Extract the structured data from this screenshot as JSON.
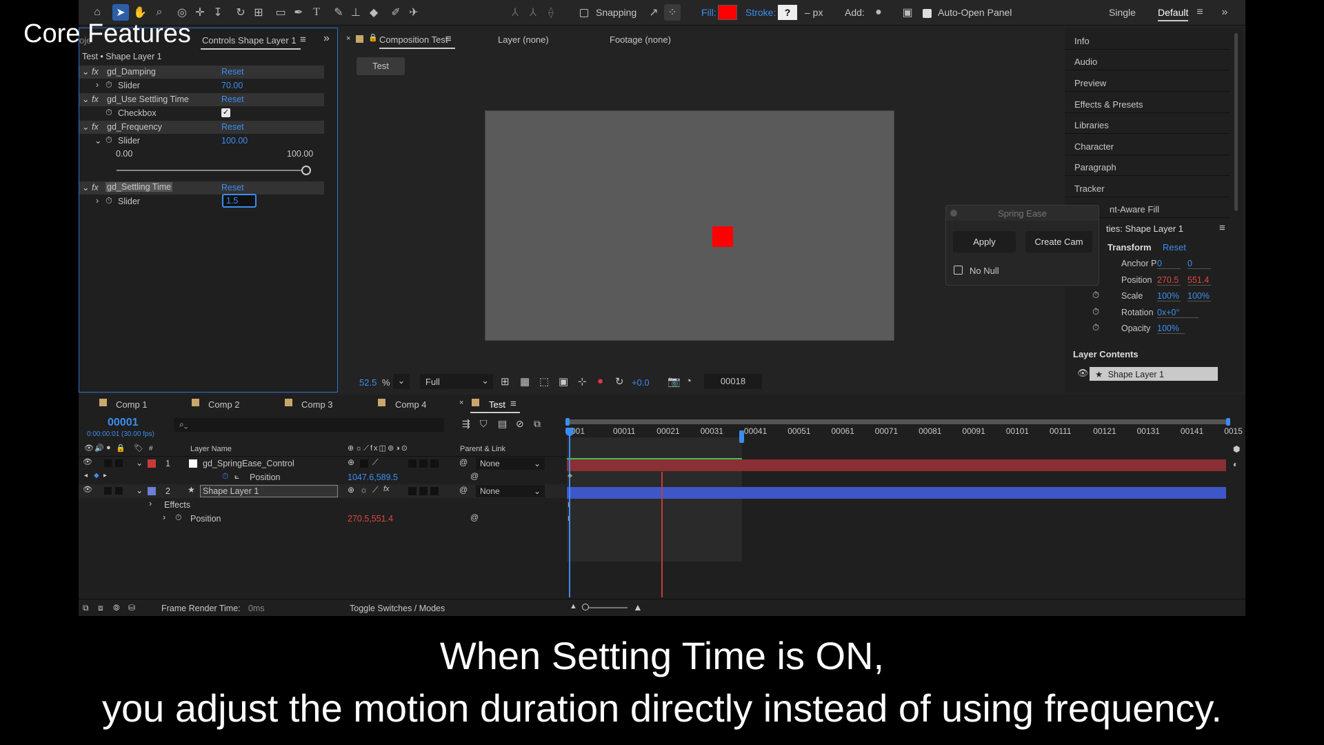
{
  "overlay_title": "Core Features",
  "subtitles": {
    "line1": "When Setting Time is ON,",
    "line2": "you adjust the motion duration directly instead of using frequency."
  },
  "toolbar": {
    "snapping": "Snapping",
    "fill": "Fill:",
    "stroke": "Stroke:",
    "stroke_value": "?",
    "stroke_unit": "– px",
    "add": "Add:",
    "auto_open": "Auto-Open Panel",
    "workspace_single": "Single",
    "workspace_default": "Default",
    "fill_color": "#ff0000"
  },
  "effect_controls": {
    "tab_partial": "oje",
    "tab_title": "Controls Shape Layer 1",
    "breadcrumb": "Test • Shape Layer 1",
    "reset": "Reset",
    "effects": [
      {
        "name": "gd_Damping",
        "param": "Slider",
        "value": "70.00"
      },
      {
        "name": "gd_Use Settling Time",
        "param": "Checkbox",
        "value": ""
      },
      {
        "name": "gd_Frequency",
        "param": "Slider",
        "value": "100.00",
        "min": "0.00",
        "max": "100.00"
      },
      {
        "name": "gd_Settling Time",
        "param": "Slider",
        "value": "1.5"
      }
    ]
  },
  "composition": {
    "tab": "Composition Test",
    "layer_tab": "Layer (none)",
    "footage_tab": "Footage (none)",
    "comp_button": "Test",
    "zoom": "52.5",
    "zoom_unit": "%",
    "resolution": "Full",
    "exposure": "+0.0",
    "timecode": "00018"
  },
  "spring_ease": {
    "title": "Spring Ease",
    "apply": "Apply",
    "create_cam": "Create Cam",
    "no_null": "No Null"
  },
  "right_panel": {
    "items": [
      "Info",
      "Audio",
      "Preview",
      "Effects & Presets",
      "Libraries",
      "Character",
      "Paragraph",
      "Tracker",
      "nt-Aware Fill"
    ],
    "props_title": "ties: Shape Layer 1",
    "transform": "Transform",
    "reset": "Reset",
    "anchor_label": "Anchor P",
    "anchor_x": "0",
    "anchor_y": "0",
    "position_label": "Position",
    "position_x": "270.5",
    "position_y": "551.4",
    "scale_label": "Scale",
    "scale_x": "100%",
    "scale_y": "100%",
    "rotation_label": "Rotation",
    "rotation_value": "0x+0°",
    "opacity_label": "Opacity",
    "opacity_value": "100%",
    "layer_contents": "Layer Contents",
    "layer_item": "Shape Layer 1"
  },
  "timeline": {
    "tabs": [
      "Comp 1",
      "Comp 2",
      "Comp 3",
      "Comp 4",
      "Test"
    ],
    "timecode": "00001",
    "timecode_sub": "0:00:00:01 (30.00 fps)",
    "layer_name_header": "Layer Name",
    "parent_header": "Parent & Link",
    "layers": [
      {
        "num": "1",
        "name": "gd_SpringEase_Control",
        "parent": "None"
      },
      {
        "num": "2",
        "name": "Shape Layer 1",
        "parent": "None"
      }
    ],
    "prop_position": "Position",
    "prop_position_value": "1047.6,589.5",
    "effects_label": "Effects",
    "prop2_position": "Position",
    "prop2_position_value": "270.5,551.4",
    "ruler": [
      "00011",
      "00021",
      "00031",
      "00041",
      "00051",
      "00061",
      "00071",
      "00081",
      "00091",
      "00101",
      "00111",
      "00121",
      "00131",
      "00141",
      "0015"
    ],
    "ruler_start": "001",
    "frame_render": "Frame Render Time:",
    "frame_render_value": "0ms",
    "toggle": "Toggle Switches / Modes"
  }
}
